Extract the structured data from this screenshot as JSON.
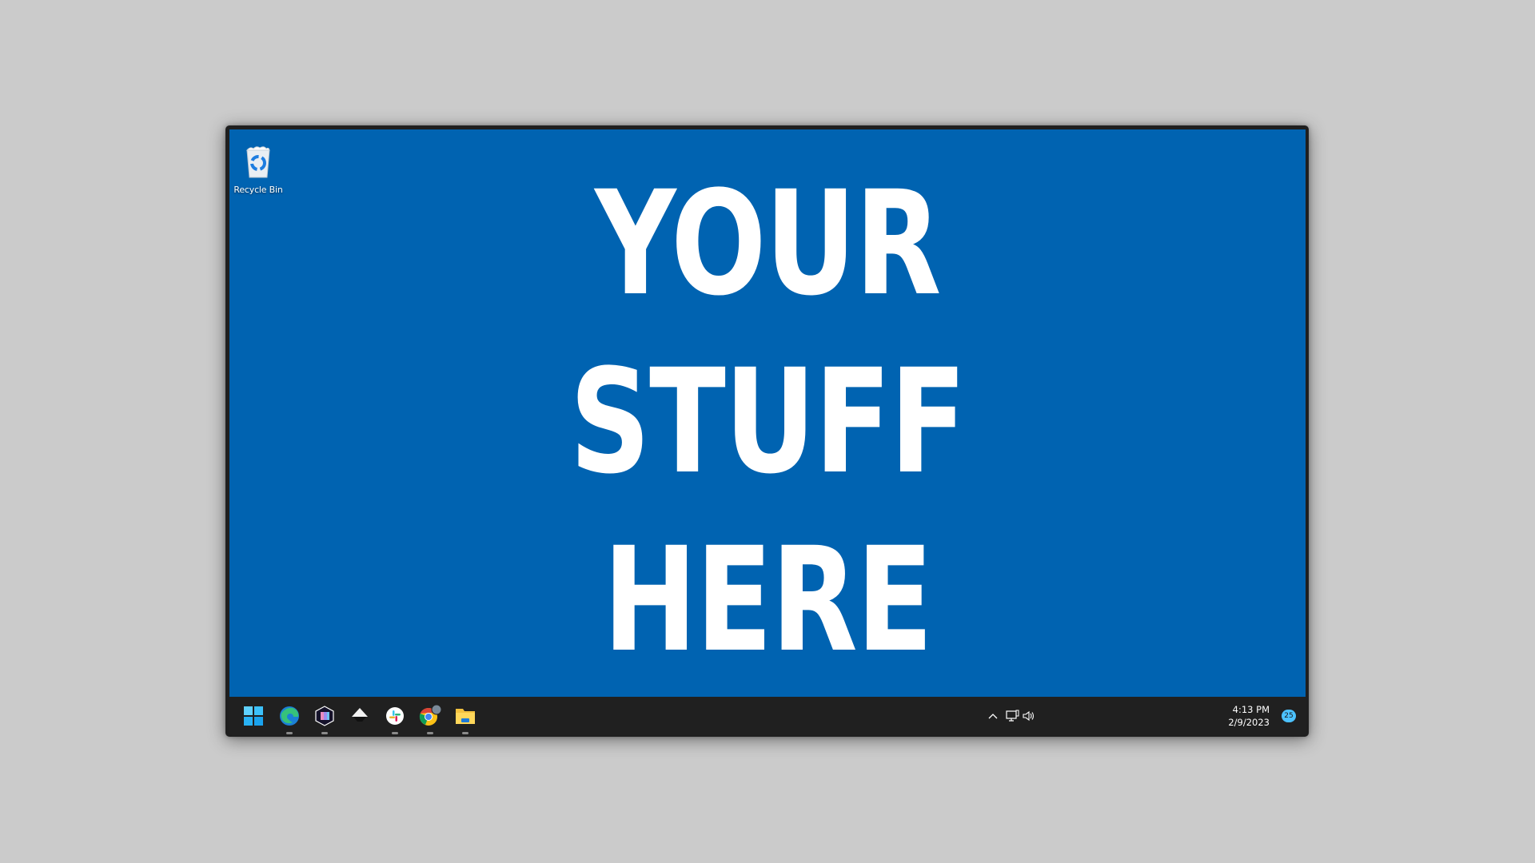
{
  "desktop": {
    "background_color": "#0063b1",
    "icons": [
      {
        "label": "Recycle Bin",
        "icon": "recycle-bin-icon"
      }
    ],
    "headline": [
      "YOUR",
      "STUFF",
      "HERE"
    ]
  },
  "taskbar": {
    "pinned": [
      {
        "name": "start",
        "icon": "windows-start-icon",
        "running": false
      },
      {
        "name": "edge",
        "icon": "edge-icon",
        "running": true
      },
      {
        "name": "app-3",
        "icon": "hexagon-app-icon",
        "running": true
      },
      {
        "name": "inkscape",
        "icon": "inkscape-icon",
        "running": false
      },
      {
        "name": "slack",
        "icon": "slack-icon",
        "running": true
      },
      {
        "name": "chrome",
        "icon": "chrome-icon",
        "running": true
      },
      {
        "name": "file-explorer",
        "icon": "folder-icon",
        "running": true
      }
    ],
    "tray": {
      "time": "4:13 PM",
      "date": "2/9/2023",
      "notification_count": "25"
    }
  }
}
